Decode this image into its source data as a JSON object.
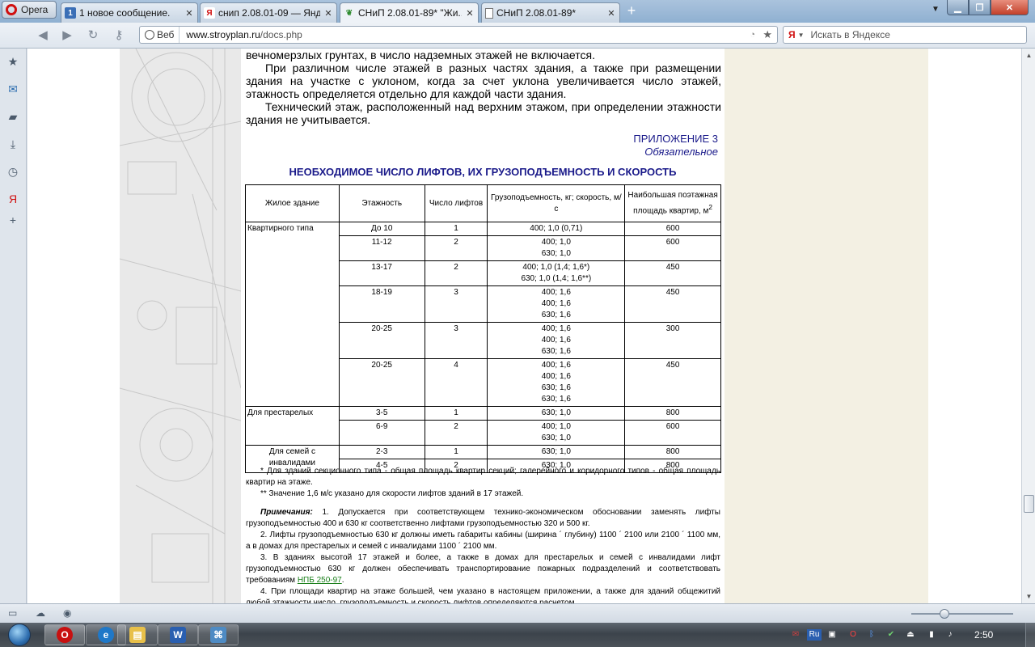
{
  "browser": {
    "menu_label": "Opera",
    "tabs": [
      {
        "title": "1 новое сообщение.",
        "icon": "1",
        "active": false
      },
      {
        "title": "снип 2.08.01-09 — Янд...",
        "icon": "Я",
        "active": false
      },
      {
        "title": "СНиП 2.08.01-89* \"Жи...",
        "icon": "leaf",
        "active": true
      },
      {
        "title": "СНиП 2.08.01-89*",
        "icon": "page",
        "active": false
      }
    ],
    "web_label": "Веб",
    "url_host": "www.stroyplan.ru",
    "url_path": "/docs.php",
    "search_placeholder": "Искать в Яндексе",
    "search_engine_glyph": "Я"
  },
  "page": {
    "para1": "вечномерзлых грунтах, в число надземных этажей не включается.",
    "para2": "При различном числе этажей в разных частях здания, а также при размещении здания на участке с уклоном, когда за счет уклона увеличивается число этажей, этажность определяется отдельно для каждой части здания.",
    "para3": "Технический этаж, расположенный над верхним этажом, при определении этажности здания не учитывается.",
    "appendix_title": "ПРИЛОЖЕНИЕ 3",
    "appendix_subtitle": "Обязательное",
    "table_title": "НЕОБХОДИМОЕ ЧИСЛО ЛИФТОВ, ИХ ГРУЗОПОДЪЕМНОСТЬ И СКОРОСТЬ",
    "table": {
      "headers": [
        "Жилое здание",
        "Этажность",
        "Число лифтов",
        "Грузоподъемность, кг; скорость, м/с",
        "Наибольшая поэтажная площадь квартир, м"
      ],
      "header_superscript": "2",
      "groups": [
        {
          "type": "Квартирного типа",
          "rows": [
            {
              "floors": "До 10",
              "lifts": "1",
              "capacity": "400; 1,0 (0,71)",
              "area": "600"
            },
            {
              "floors": "11-12",
              "lifts": "2",
              "capacity": "400; 1,0\n630; 1,0",
              "area": "600"
            },
            {
              "floors": "13-17",
              "lifts": "2",
              "capacity": "400; 1,0 (1,4; 1,6*)\n630; 1,0 (1,4; 1,6**)",
              "area": "450"
            },
            {
              "floors": "18-19",
              "lifts": "3",
              "capacity": "400; 1,6\n400; 1,6\n630; 1,6",
              "area": "450"
            },
            {
              "floors": "20-25",
              "lifts": "3",
              "capacity": "400; 1,6\n400; 1,6\n630; 1,6",
              "area": "300"
            },
            {
              "floors": "20-25",
              "lifts": "4",
              "capacity": "400; 1,6\n400; 1,6\n630; 1,6\n630; 1,6",
              "area": "450"
            }
          ]
        },
        {
          "type": "Для престарелых",
          "rows": [
            {
              "floors": "3-5",
              "lifts": "1",
              "capacity": "630; 1,0",
              "area": "800"
            },
            {
              "floors": "6-9",
              "lifts": "2",
              "capacity": "400; 1,0\n630; 1,0",
              "area": "600"
            }
          ]
        },
        {
          "type": "Для семей с инвалидами",
          "rows": [
            {
              "floors": "2-3",
              "lifts": "1",
              "capacity": "630; 1,0",
              "area": "800"
            },
            {
              "floors": "4-5",
              "lifts": "2",
              "capacity": "630; 1,0",
              "area": "800"
            }
          ]
        }
      ]
    },
    "footnote1": "* Для зданий секционного типа - общая площадь квартир секций; галерейного и коридорного типов - общая площадь квартир на этаже.",
    "footnote2": "** Значение 1,6 м/с указано для скорости лифтов зданий в 17 этажей.",
    "note_label": "Примечания:",
    "note1": " 1. Допускается при соответствующем технико-экономическом обосновании заменять лифты грузоподъемностью 400 и 630 кг соответственно лифтами грузоподъемностью 320 и 500 кг.",
    "note2": "2. Лифты грузоподъемностью 630 кг должны иметь габариты кабины (ширина ´ глубину) 1100 ´ 2100 или 2100 ´ 1100 мм, а в домах для престарелых и семей с инвалидами 1100 ´ 2100 мм.",
    "note3_pre": "3. В зданиях высотой 17 этажей и более, а также в домах для престарелых и семей с инвалидами лифт грузоподъемностью 630 кг должен обеспечивать транспортирование пожарных подразделений и соответствовать требованиям ",
    "note3_link": "НПБ 250-97",
    "note3_post": ".",
    "note4": "4. При площади квартир на этаже большей, чем указано в настоящем приложении, а также для зданий общежитий любой этажности число, грузоподъемность и скорость лифтов определяются расчетом."
  },
  "taskbar": {
    "clock": "2:50",
    "lang": "Ru"
  },
  "colors": {
    "heading_blue": "#1a1a8a",
    "link_green": "#1a7f1a",
    "right_column": "#f3f0e3"
  }
}
